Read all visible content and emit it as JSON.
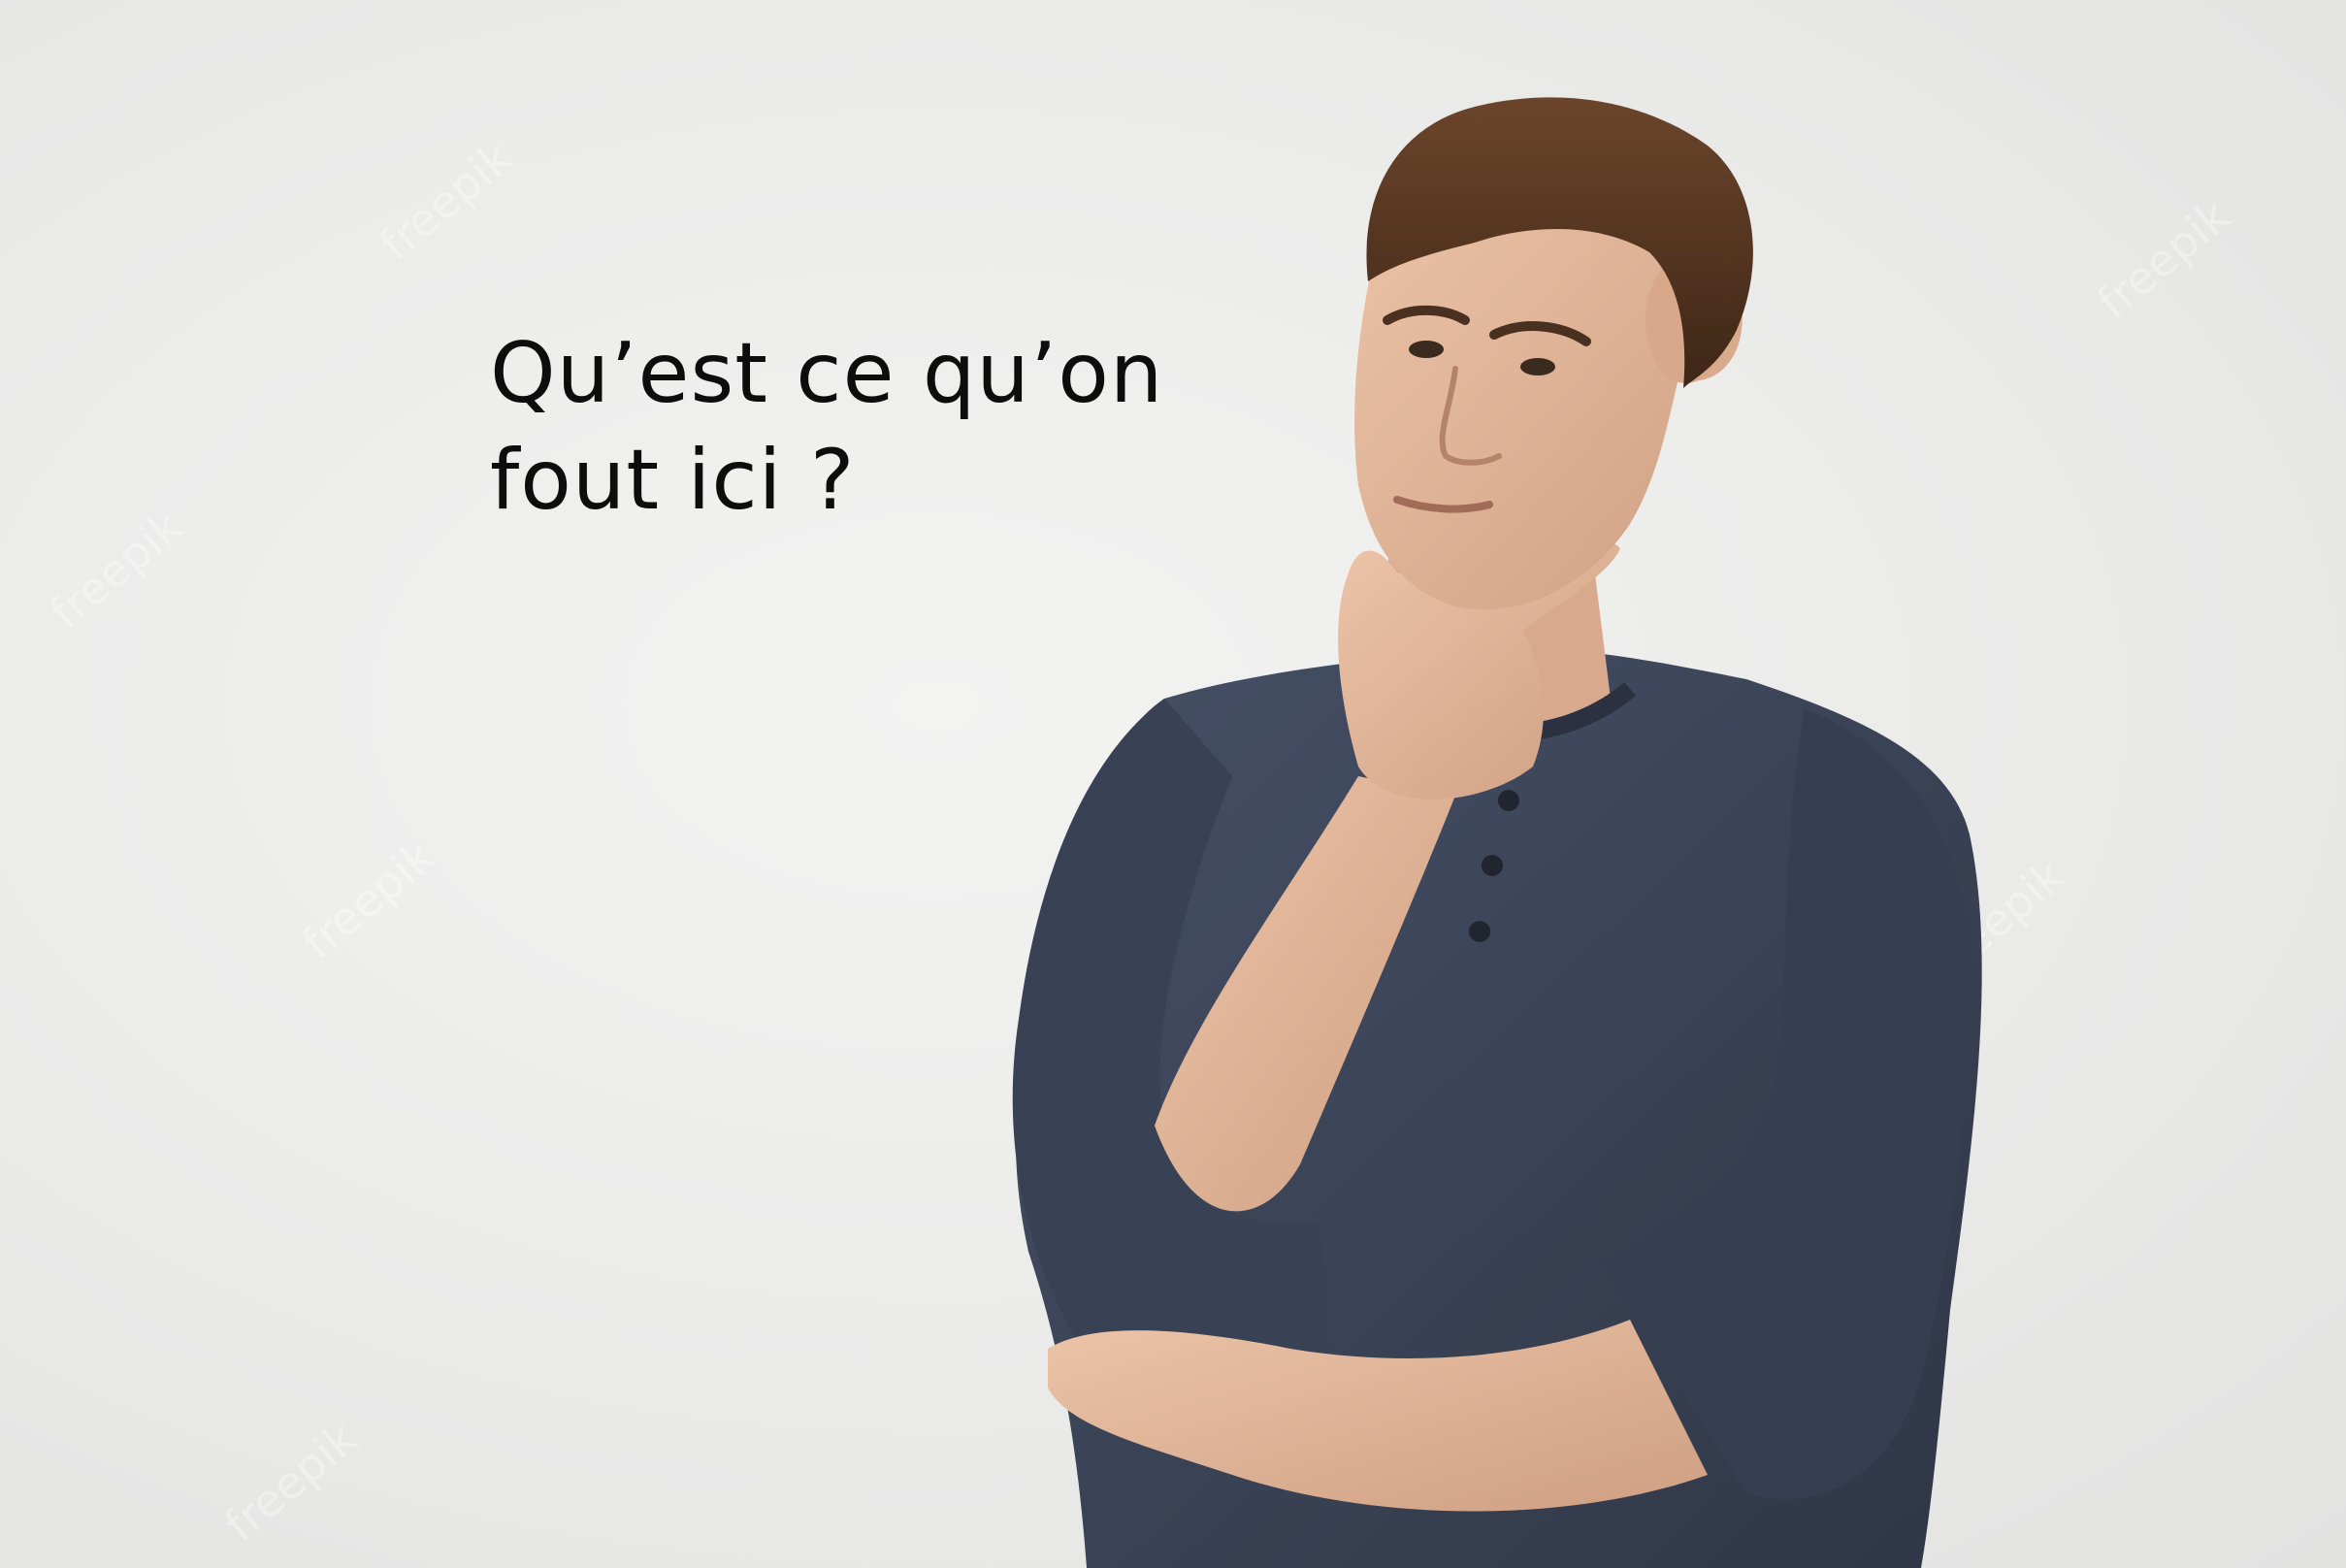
{
  "caption": {
    "line1": "Qu’est ce qu’on",
    "line2": "fout ici ?"
  },
  "photo": {
    "subject": "person-thinking",
    "background_color": "#ebebea",
    "shirt_color": "#3b4354",
    "skin_color": "#e2b79b",
    "hair_color": "#5a3a24"
  },
  "watermark": {
    "text": "freepik"
  }
}
